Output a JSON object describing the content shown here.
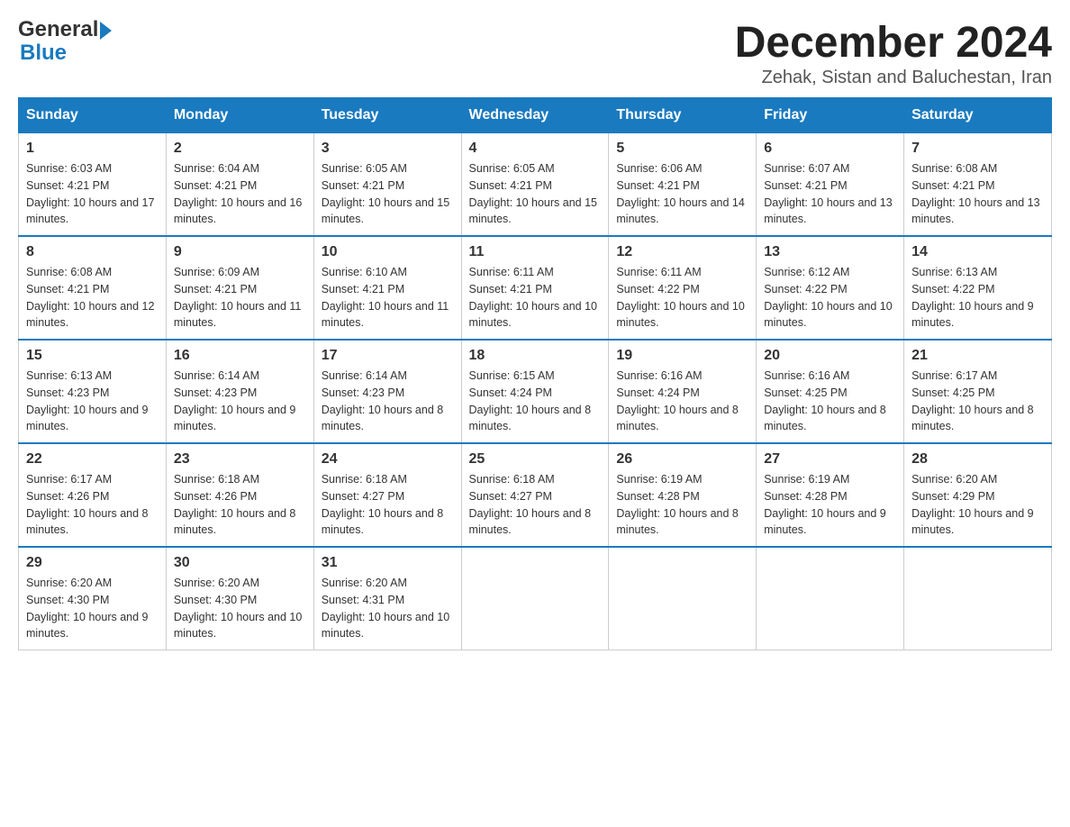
{
  "logo": {
    "text_general": "General",
    "text_blue": "Blue"
  },
  "header": {
    "month_year": "December 2024",
    "location": "Zehak, Sistan and Baluchestan, Iran"
  },
  "days_of_week": [
    "Sunday",
    "Monday",
    "Tuesday",
    "Wednesday",
    "Thursday",
    "Friday",
    "Saturday"
  ],
  "weeks": [
    [
      {
        "day": "1",
        "sunrise": "6:03 AM",
        "sunset": "4:21 PM",
        "daylight": "10 hours and 17 minutes."
      },
      {
        "day": "2",
        "sunrise": "6:04 AM",
        "sunset": "4:21 PM",
        "daylight": "10 hours and 16 minutes."
      },
      {
        "day": "3",
        "sunrise": "6:05 AM",
        "sunset": "4:21 PM",
        "daylight": "10 hours and 15 minutes."
      },
      {
        "day": "4",
        "sunrise": "6:05 AM",
        "sunset": "4:21 PM",
        "daylight": "10 hours and 15 minutes."
      },
      {
        "day": "5",
        "sunrise": "6:06 AM",
        "sunset": "4:21 PM",
        "daylight": "10 hours and 14 minutes."
      },
      {
        "day": "6",
        "sunrise": "6:07 AM",
        "sunset": "4:21 PM",
        "daylight": "10 hours and 13 minutes."
      },
      {
        "day": "7",
        "sunrise": "6:08 AM",
        "sunset": "4:21 PM",
        "daylight": "10 hours and 13 minutes."
      }
    ],
    [
      {
        "day": "8",
        "sunrise": "6:08 AM",
        "sunset": "4:21 PM",
        "daylight": "10 hours and 12 minutes."
      },
      {
        "day": "9",
        "sunrise": "6:09 AM",
        "sunset": "4:21 PM",
        "daylight": "10 hours and 11 minutes."
      },
      {
        "day": "10",
        "sunrise": "6:10 AM",
        "sunset": "4:21 PM",
        "daylight": "10 hours and 11 minutes."
      },
      {
        "day": "11",
        "sunrise": "6:11 AM",
        "sunset": "4:21 PM",
        "daylight": "10 hours and 10 minutes."
      },
      {
        "day": "12",
        "sunrise": "6:11 AM",
        "sunset": "4:22 PM",
        "daylight": "10 hours and 10 minutes."
      },
      {
        "day": "13",
        "sunrise": "6:12 AM",
        "sunset": "4:22 PM",
        "daylight": "10 hours and 10 minutes."
      },
      {
        "day": "14",
        "sunrise": "6:13 AM",
        "sunset": "4:22 PM",
        "daylight": "10 hours and 9 minutes."
      }
    ],
    [
      {
        "day": "15",
        "sunrise": "6:13 AM",
        "sunset": "4:23 PM",
        "daylight": "10 hours and 9 minutes."
      },
      {
        "day": "16",
        "sunrise": "6:14 AM",
        "sunset": "4:23 PM",
        "daylight": "10 hours and 9 minutes."
      },
      {
        "day": "17",
        "sunrise": "6:14 AM",
        "sunset": "4:23 PM",
        "daylight": "10 hours and 8 minutes."
      },
      {
        "day": "18",
        "sunrise": "6:15 AM",
        "sunset": "4:24 PM",
        "daylight": "10 hours and 8 minutes."
      },
      {
        "day": "19",
        "sunrise": "6:16 AM",
        "sunset": "4:24 PM",
        "daylight": "10 hours and 8 minutes."
      },
      {
        "day": "20",
        "sunrise": "6:16 AM",
        "sunset": "4:25 PM",
        "daylight": "10 hours and 8 minutes."
      },
      {
        "day": "21",
        "sunrise": "6:17 AM",
        "sunset": "4:25 PM",
        "daylight": "10 hours and 8 minutes."
      }
    ],
    [
      {
        "day": "22",
        "sunrise": "6:17 AM",
        "sunset": "4:26 PM",
        "daylight": "10 hours and 8 minutes."
      },
      {
        "day": "23",
        "sunrise": "6:18 AM",
        "sunset": "4:26 PM",
        "daylight": "10 hours and 8 minutes."
      },
      {
        "day": "24",
        "sunrise": "6:18 AM",
        "sunset": "4:27 PM",
        "daylight": "10 hours and 8 minutes."
      },
      {
        "day": "25",
        "sunrise": "6:18 AM",
        "sunset": "4:27 PM",
        "daylight": "10 hours and 8 minutes."
      },
      {
        "day": "26",
        "sunrise": "6:19 AM",
        "sunset": "4:28 PM",
        "daylight": "10 hours and 8 minutes."
      },
      {
        "day": "27",
        "sunrise": "6:19 AM",
        "sunset": "4:28 PM",
        "daylight": "10 hours and 9 minutes."
      },
      {
        "day": "28",
        "sunrise": "6:20 AM",
        "sunset": "4:29 PM",
        "daylight": "10 hours and 9 minutes."
      }
    ],
    [
      {
        "day": "29",
        "sunrise": "6:20 AM",
        "sunset": "4:30 PM",
        "daylight": "10 hours and 9 minutes."
      },
      {
        "day": "30",
        "sunrise": "6:20 AM",
        "sunset": "4:30 PM",
        "daylight": "10 hours and 10 minutes."
      },
      {
        "day": "31",
        "sunrise": "6:20 AM",
        "sunset": "4:31 PM",
        "daylight": "10 hours and 10 minutes."
      },
      null,
      null,
      null,
      null
    ]
  ]
}
